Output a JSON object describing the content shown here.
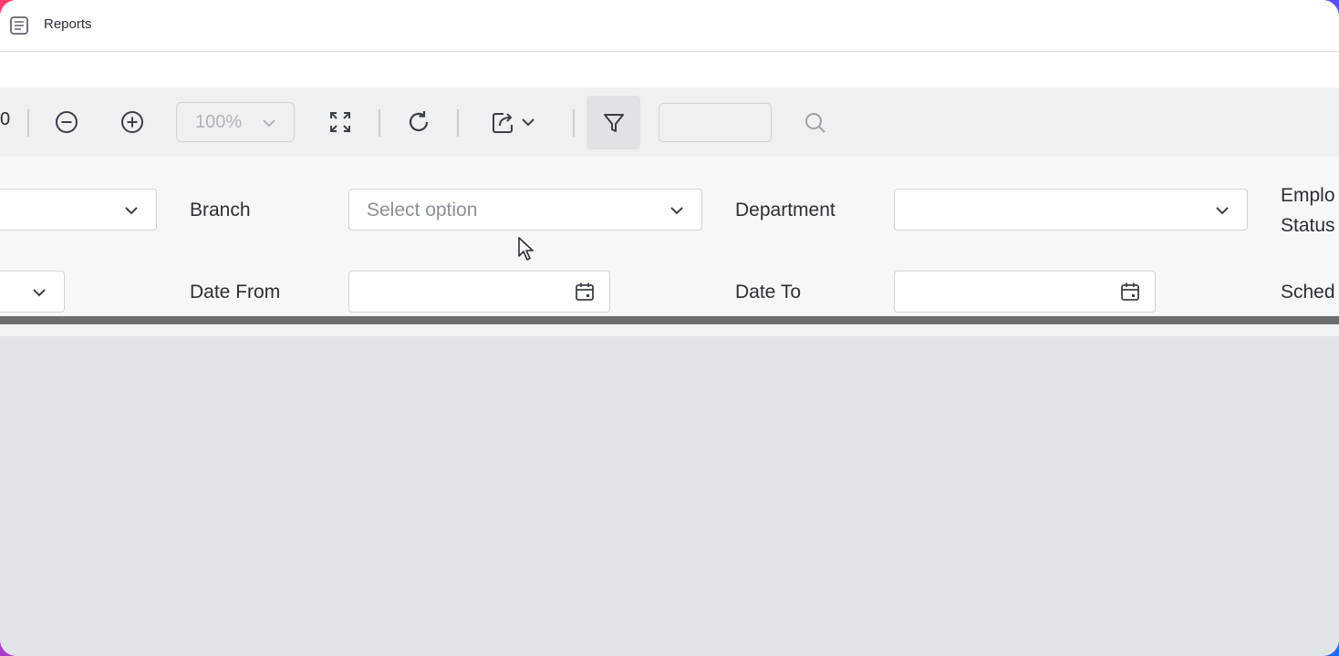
{
  "window": {
    "title": "Reports"
  },
  "toolbar": {
    "page_number": "0",
    "zoom_value": "100%",
    "icons": [
      "zoom-out-icon",
      "zoom-in-icon",
      "chevron-down-icon",
      "fit-page-icon",
      "refresh-icon",
      "export-icon",
      "filter-icon",
      "search-icon"
    ]
  },
  "filters": {
    "branch_label": "Branch",
    "branch_placeholder": "Select option",
    "department_label": "Department",
    "employment_status_label_line1": "Emplo",
    "employment_status_label_line2": "Status",
    "date_from_label": "Date From",
    "date_to_label": "Date To",
    "schedule_label": "Sched"
  },
  "colors": {
    "titlebar_bg": "#ffffff",
    "toolbar_bg": "#eef0f2",
    "filter_panel_bg": "#f6f7f8",
    "progress_bar": "#6b6d70",
    "content_bg": "#e1e4e7"
  }
}
